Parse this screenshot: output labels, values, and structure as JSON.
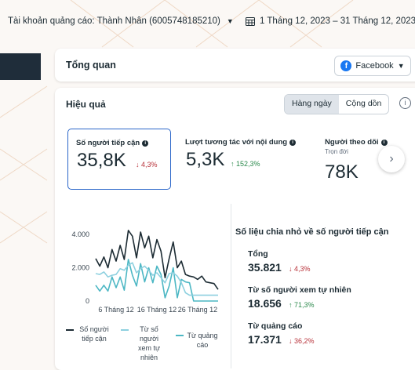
{
  "top": {
    "account": "Tài khoản quảng cáo: Thành Nhân (6005748185210)",
    "date_range": "1 Tháng 12, 2023 – 31 Tháng 12, 2023",
    "calendar_icon": "calendar-icon"
  },
  "overview": {
    "title": "Tổng quan",
    "platform": "Facebook"
  },
  "performance": {
    "title": "Hiệu quả",
    "toggle": [
      "Hàng ngày",
      "Cộng dồn"
    ],
    "active_toggle": "Hàng ngày",
    "metrics": [
      {
        "label": "Số người tiếp cận",
        "value": "35,8K",
        "delta": "↓ 4,3%",
        "direction": "down"
      },
      {
        "label": "Lượt tương tác với nội dung",
        "value": "5,3K",
        "delta": "↑ 152,3%",
        "direction": "up"
      },
      {
        "label": "Người theo dõi",
        "sublabel": "Trọn đời",
        "value": "78K"
      }
    ]
  },
  "chart_data": {
    "type": "line",
    "yticks": [
      "4.000",
      "2.000",
      "0"
    ],
    "ylim": [
      0,
      5000
    ],
    "xticks": [
      "6 Tháng 12",
      "16 Tháng 12",
      "26 Tháng 12"
    ],
    "x": [
      1,
      2,
      3,
      4,
      5,
      6,
      7,
      8,
      9,
      10,
      11,
      12,
      13,
      14,
      15,
      16,
      17,
      18,
      19,
      20,
      21,
      22,
      23,
      24,
      25,
      26,
      27,
      28,
      29,
      30,
      31
    ],
    "series": [
      {
        "name": "Số người tiếp cận",
        "color": "#1c2b33",
        "values": [
          2550,
          2100,
          2650,
          2000,
          3100,
          2400,
          3350,
          2500,
          4250,
          3900,
          2600,
          4150,
          3200,
          3900,
          2600,
          3700,
          3000,
          1400,
          2550,
          3550,
          2000,
          2400,
          1600,
          1500,
          1450,
          1300,
          1500,
          1150,
          1100,
          1050,
          700
        ]
      },
      {
        "name": "Từ số người xem tự nhiên",
        "color": "#8dd0df",
        "values": [
          1650,
          1600,
          1750,
          1450,
          1550,
          1600,
          1950,
          1850,
          2150,
          2300,
          1700,
          1950,
          2100,
          1850,
          1550,
          1700,
          1400,
          1100,
          1650,
          1700,
          1500,
          1100,
          500,
          350,
          350,
          350,
          350,
          350,
          350,
          350,
          350
        ]
      },
      {
        "name": "Từ quảng cáo",
        "color": "#4cb7c4",
        "values": [
          950,
          600,
          950,
          600,
          1450,
          800,
          1450,
          650,
          2500,
          1550,
          900,
          2250,
          1150,
          2000,
          1100,
          2100,
          1600,
          200,
          900,
          2000,
          200,
          1300,
          1150,
          1100,
          0,
          0,
          0,
          0,
          0,
          0,
          0
        ]
      }
    ],
    "legend": [
      "Số người tiếp cận",
      "Từ số người xem tự nhiên",
      "Từ quảng cáo"
    ]
  },
  "breakdown": {
    "title": "Số liệu chia nhỏ về số người tiếp cận",
    "rows": [
      {
        "label": "Tổng",
        "value": "35.821",
        "delta": "↓ 4,3%",
        "direction": "down"
      },
      {
        "label": "Từ số người xem tự nhiên",
        "value": "18.656",
        "delta": "↑ 71,3%",
        "direction": "up"
      },
      {
        "label": "Từ quảng cáo",
        "value": "17.371",
        "delta": "↓ 36,2%",
        "direction": "down"
      }
    ]
  }
}
